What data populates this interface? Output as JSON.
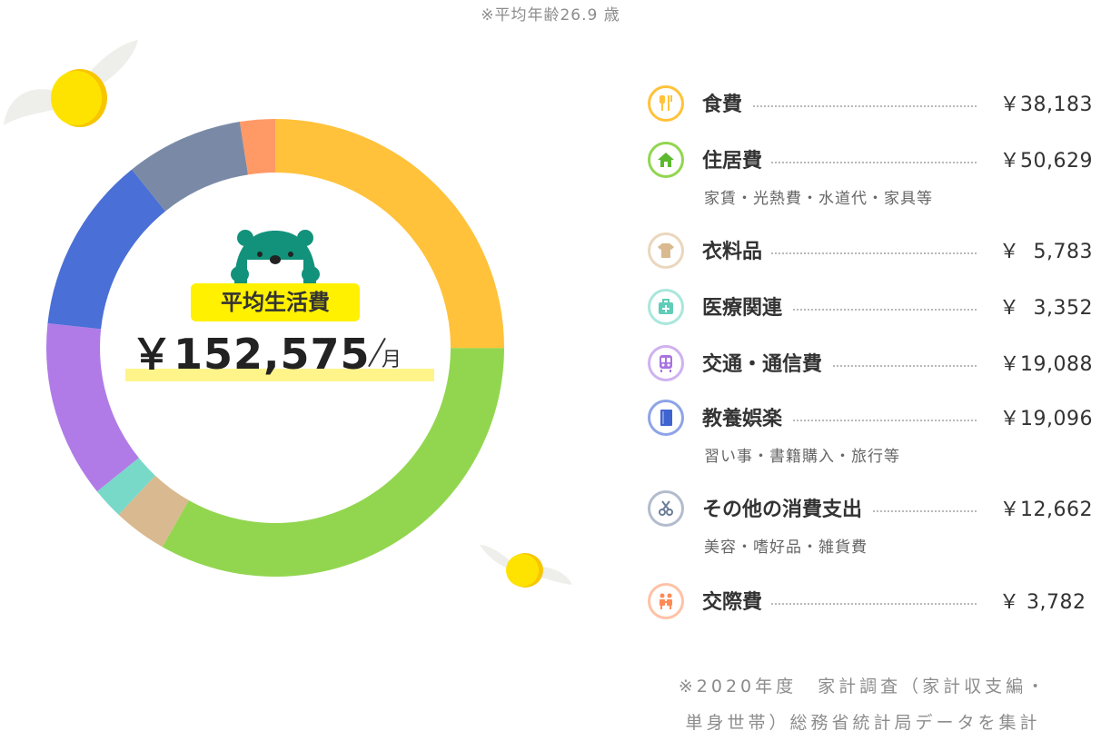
{
  "header": {
    "age_note": "※平均年齢26.9 歳"
  },
  "center": {
    "label": "平均生活費",
    "total": "￥152,575",
    "unit": "月"
  },
  "colors": {
    "food": "#ffc23a",
    "housing": "#92d64f",
    "clothing": "#d9b98f",
    "medical": "#78d9c8",
    "transport": "#b07be6",
    "education": "#4a6fd6",
    "other": "#7a8aa6",
    "social": "#ff9966"
  },
  "chart_data": {
    "type": "pie",
    "title": "",
    "categories": [
      "食費",
      "住居費",
      "衣料品",
      "医療関連",
      "交通・通信費",
      "教養娯楽",
      "その他の消費支出",
      "交際費"
    ],
    "values": [
      38183,
      50629,
      5783,
      3352,
      19088,
      19096,
      12662,
      3782
    ],
    "colors": [
      "#ffc23a",
      "#92d64f",
      "#d9b98f",
      "#78d9c8",
      "#b07be6",
      "#4a6fd6",
      "#7a8aa6",
      "#ff9966"
    ],
    "donut": true,
    "total": 152575
  },
  "legend": [
    {
      "name": "食費",
      "value": "￥38,183",
      "icon": "food-icon"
    },
    {
      "name": "住居費",
      "value": "￥50,629",
      "sub": "家賃・光熱費・水道代・家具等",
      "icon": "house-icon"
    },
    {
      "name": "衣料品",
      "value": "￥  5,783",
      "icon": "shirt-icon"
    },
    {
      "name": "医療関連",
      "value": "￥  3,352",
      "icon": "medical-icon"
    },
    {
      "name": "交通・通信費",
      "value": "￥19,088",
      "icon": "train-icon"
    },
    {
      "name": "教養娯楽",
      "value": "￥19,096",
      "sub": "習い事・書籍購入・旅行等",
      "icon": "book-icon"
    },
    {
      "name": "その他の消費支出",
      "value": "￥12,662",
      "sub": "美容・嗜好品・雑貨費",
      "icon": "scissors-icon"
    },
    {
      "name": "交際費",
      "value": "￥ 3,782 ",
      "icon": "people-icon"
    }
  ],
  "footer": {
    "source_line1": "※2020年度　家計調査（家計収支編・",
    "source_line2": "単身世帯）総務省統計局データを集計"
  }
}
